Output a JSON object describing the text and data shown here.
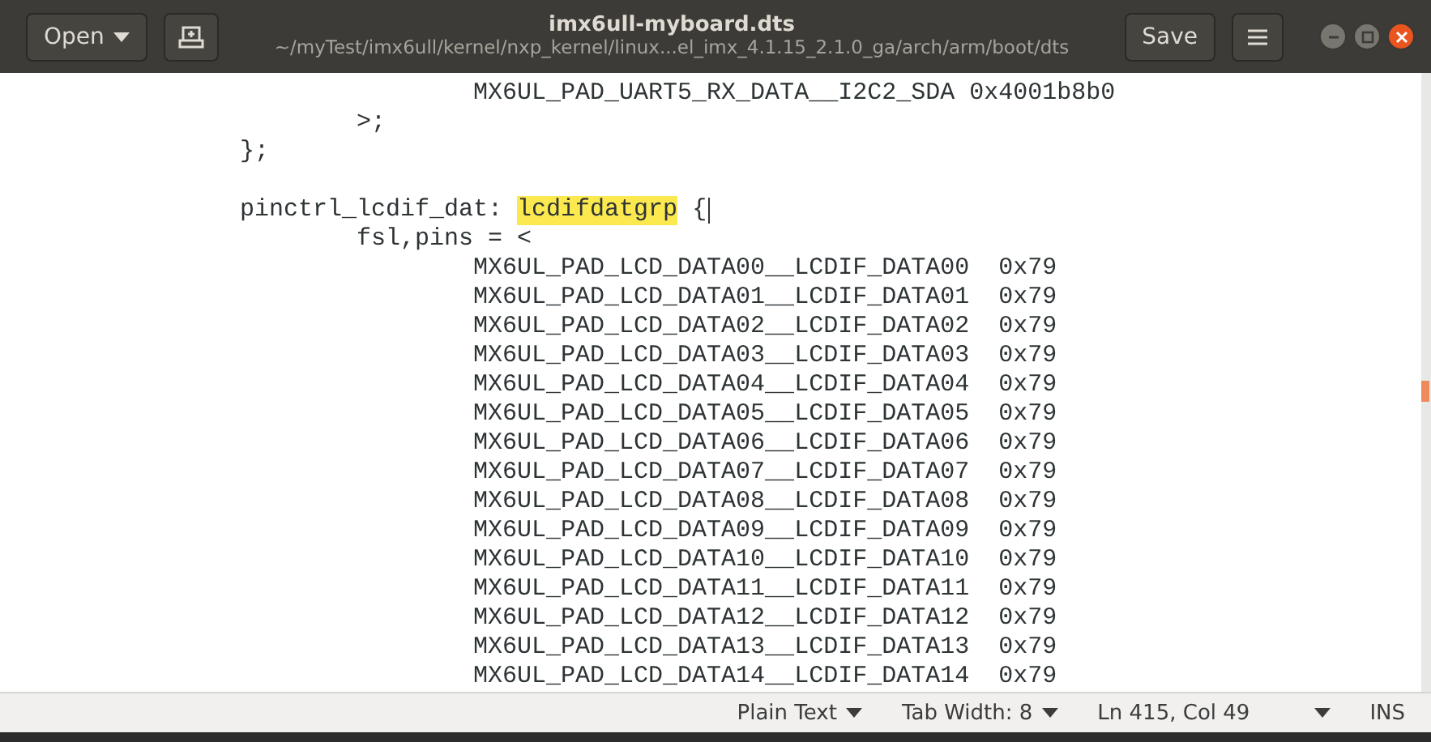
{
  "header": {
    "open_button": "Open",
    "title": "imx6ull-myboard.dts",
    "subtitle": "~/myTest/imx6ull/kernel/nxp_kernel/linux...el_imx_4.1.15_2.1.0_ga/arch/arm/boot/dts",
    "save_button": "Save"
  },
  "editor": {
    "lines": [
      {
        "kind": "code",
        "segments": [
          {
            "text": "\t\tMX6UL_PAD_UART5_RX_DATA__I2C2_SDA 0x4001b8b0",
            "highlighted": false
          }
        ],
        "cursor": false
      },
      {
        "kind": "code",
        "segments": [
          {
            "text": "\t>;",
            "highlighted": false
          }
        ],
        "cursor": false
      },
      {
        "kind": "code",
        "segments": [
          {
            "text": "};",
            "highlighted": false
          }
        ],
        "cursor": false
      },
      {
        "kind": "blank"
      },
      {
        "kind": "code",
        "segments": [
          {
            "text": "pinctrl_lcdif_dat: ",
            "highlighted": false
          },
          {
            "text": "lcdifdatgrp",
            "highlighted": true
          },
          {
            "text": " {",
            "highlighted": false
          }
        ],
        "cursor": true
      },
      {
        "kind": "code",
        "segments": [
          {
            "text": "\tfsl,pins = <",
            "highlighted": false
          }
        ],
        "cursor": false
      },
      {
        "kind": "code",
        "segments": [
          {
            "text": "\t\tMX6UL_PAD_LCD_DATA00__LCDIF_DATA00  0x79",
            "highlighted": false
          }
        ],
        "cursor": false
      },
      {
        "kind": "code",
        "segments": [
          {
            "text": "\t\tMX6UL_PAD_LCD_DATA01__LCDIF_DATA01  0x79",
            "highlighted": false
          }
        ],
        "cursor": false
      },
      {
        "kind": "code",
        "segments": [
          {
            "text": "\t\tMX6UL_PAD_LCD_DATA02__LCDIF_DATA02  0x79",
            "highlighted": false
          }
        ],
        "cursor": false
      },
      {
        "kind": "code",
        "segments": [
          {
            "text": "\t\tMX6UL_PAD_LCD_DATA03__LCDIF_DATA03  0x79",
            "highlighted": false
          }
        ],
        "cursor": false
      },
      {
        "kind": "code",
        "segments": [
          {
            "text": "\t\tMX6UL_PAD_LCD_DATA04__LCDIF_DATA04  0x79",
            "highlighted": false
          }
        ],
        "cursor": false
      },
      {
        "kind": "code",
        "segments": [
          {
            "text": "\t\tMX6UL_PAD_LCD_DATA05__LCDIF_DATA05  0x79",
            "highlighted": false
          }
        ],
        "cursor": false
      },
      {
        "kind": "code",
        "segments": [
          {
            "text": "\t\tMX6UL_PAD_LCD_DATA06__LCDIF_DATA06  0x79",
            "highlighted": false
          }
        ],
        "cursor": false
      },
      {
        "kind": "code",
        "segments": [
          {
            "text": "\t\tMX6UL_PAD_LCD_DATA07__LCDIF_DATA07  0x79",
            "highlighted": false
          }
        ],
        "cursor": false
      },
      {
        "kind": "code",
        "segments": [
          {
            "text": "\t\tMX6UL_PAD_LCD_DATA08__LCDIF_DATA08  0x79",
            "highlighted": false
          }
        ],
        "cursor": false
      },
      {
        "kind": "code",
        "segments": [
          {
            "text": "\t\tMX6UL_PAD_LCD_DATA09__LCDIF_DATA09  0x79",
            "highlighted": false
          }
        ],
        "cursor": false
      },
      {
        "kind": "code",
        "segments": [
          {
            "text": "\t\tMX6UL_PAD_LCD_DATA10__LCDIF_DATA10  0x79",
            "highlighted": false
          }
        ],
        "cursor": false
      },
      {
        "kind": "code",
        "segments": [
          {
            "text": "\t\tMX6UL_PAD_LCD_DATA11__LCDIF_DATA11  0x79",
            "highlighted": false
          }
        ],
        "cursor": false
      },
      {
        "kind": "code",
        "segments": [
          {
            "text": "\t\tMX6UL_PAD_LCD_DATA12__LCDIF_DATA12  0x79",
            "highlighted": false
          }
        ],
        "cursor": false
      },
      {
        "kind": "code",
        "segments": [
          {
            "text": "\t\tMX6UL_PAD_LCD_DATA13__LCDIF_DATA13  0x79",
            "highlighted": false
          }
        ],
        "cursor": false
      },
      {
        "kind": "code",
        "segments": [
          {
            "text": "\t\tMX6UL_PAD_LCD_DATA14__LCDIF_DATA14  0x79",
            "highlighted": false
          }
        ],
        "cursor": false
      }
    ]
  },
  "status_bar": {
    "language": "Plain Text",
    "tab_width": "Tab Width: 8",
    "position": "Ln 415, Col 49",
    "mode": "INS"
  }
}
